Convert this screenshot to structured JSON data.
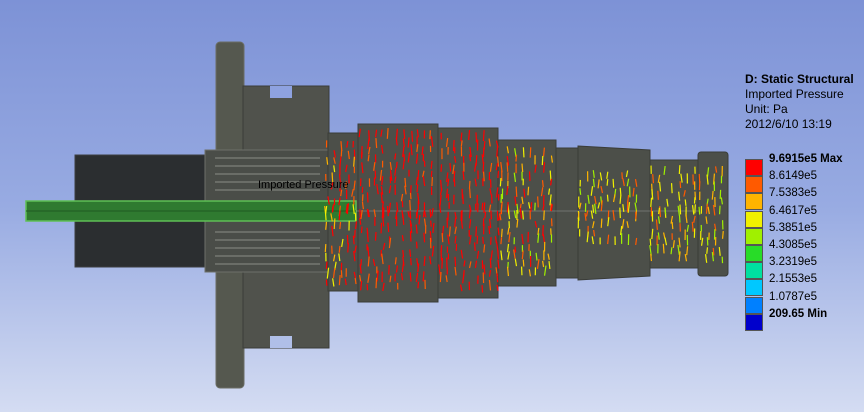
{
  "legend": {
    "title": "D: Static Structural",
    "subtitle": "Imported Pressure",
    "unit": "Unit: Pa",
    "timestamp": "2012/6/10 13:19",
    "levels": [
      {
        "label": "9.6915e5 Max",
        "color": "#ff0000",
        "bold": true
      },
      {
        "label": "8.6149e5",
        "color": "#ff5a00",
        "bold": false
      },
      {
        "label": "7.5383e5",
        "color": "#ffb400",
        "bold": false
      },
      {
        "label": "6.4617e5",
        "color": "#f0f000",
        "bold": false
      },
      {
        "label": "5.3851e5",
        "color": "#a0f000",
        "bold": false
      },
      {
        "label": "4.3085e5",
        "color": "#28dc28",
        "bold": false
      },
      {
        "label": "3.2319e5",
        "color": "#00e0a0",
        "bold": false
      },
      {
        "label": "2.1553e5",
        "color": "#00c8ff",
        "bold": false
      },
      {
        "label": "1.0787e5",
        "color": "#0080ff",
        "bold": false
      },
      {
        "label": "209.65 Min",
        "color": "#0000cc",
        "bold": true
      }
    ]
  },
  "probe_label": "Imported Pressure",
  "colors": {
    "background_top": "#7d92d6",
    "background_bottom": "#d4dcf2",
    "model_gray": "#4a4d48",
    "model_dark": "#2b2e30",
    "shaft_green": "#2f7a30"
  }
}
